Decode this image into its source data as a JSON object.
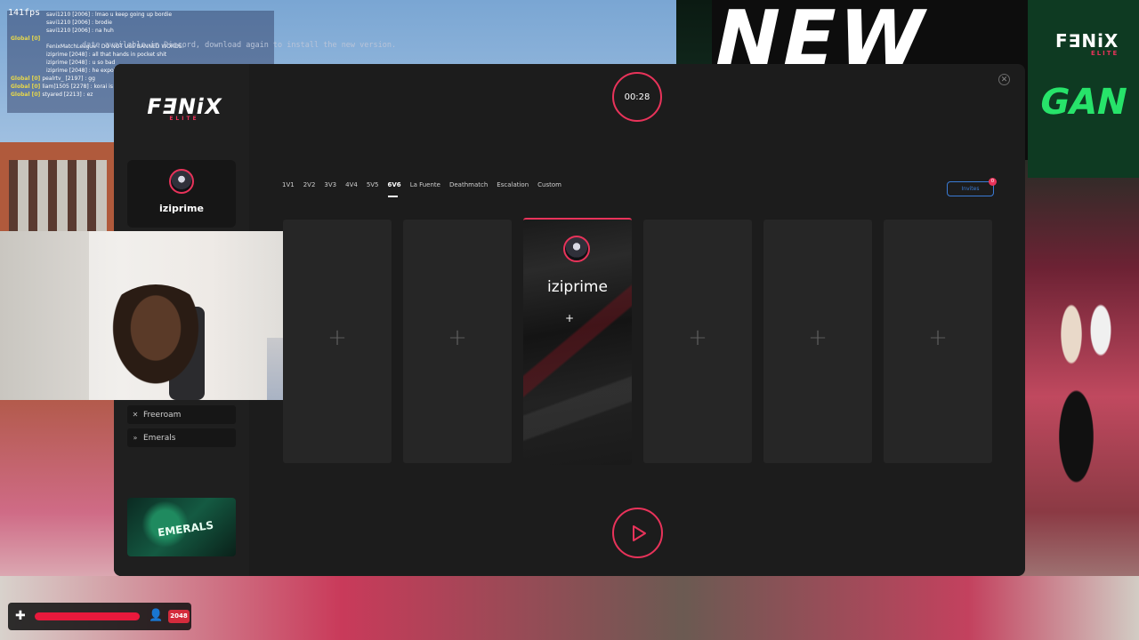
{
  "overlay": {
    "fps": "141fps",
    "update_notice": "date available in Discord, download again to install the new version."
  },
  "chat": {
    "lines": [
      {
        "prefix": "",
        "name": "savi1210 [2006] : ",
        "text": "lmao u keep going up bordie"
      },
      {
        "prefix": "",
        "name": "savi1210 [2006] : ",
        "text": "brodie"
      },
      {
        "prefix": "",
        "name": "savi1210 [2006] : ",
        "text": "na huh"
      },
      {
        "prefix": "Global [0] ",
        "name": "",
        "text": ""
      },
      {
        "prefix": "",
        "name": "FenixMatchLeague : ",
        "text": "DO NOT USE BANNED WORDS!"
      },
      {
        "prefix": "",
        "name": "iziprime [2048] : ",
        "text": "all that hands in pocket shit"
      },
      {
        "prefix": "",
        "name": "iziprime [2048] : ",
        "text": "u so bad"
      },
      {
        "prefix": "",
        "name": "iziprime [2048] : ",
        "text": "he expoiting"
      },
      {
        "prefix": "Global [0] ",
        "name": "pealrtv_ [2197] : ",
        "text": "gg"
      },
      {
        "prefix": "Global [0] ",
        "name": "liam]1505 [2278] : ",
        "text": "korai is cheat"
      },
      {
        "prefix": "Global [0] ",
        "name": "styared [2213] : ",
        "text": "ez"
      }
    ]
  },
  "brand": {
    "name": "F∃NiX",
    "sub": "ELITE",
    "corner_name": "F∃NiX",
    "corner_sub": "ELITE"
  },
  "background": {
    "sign_text": "NEW",
    "sign_text2": "GAN"
  },
  "sidebar": {
    "profile_name": "iziprime",
    "items": [
      {
        "label": "Freeroam",
        "icon": "x-icon"
      },
      {
        "label": "Emerals",
        "icon": "chevrons-icon"
      }
    ],
    "promo_text": "EMERALS"
  },
  "lobby": {
    "timer": "00:28",
    "tabs": [
      {
        "label": "1V1",
        "active": false
      },
      {
        "label": "2V2",
        "active": false
      },
      {
        "label": "3V3",
        "active": false
      },
      {
        "label": "4V4",
        "active": false
      },
      {
        "label": "5V5",
        "active": false
      },
      {
        "label": "6V6",
        "active": true
      },
      {
        "label": "La Fuente",
        "active": false
      },
      {
        "label": "Deathmatch",
        "active": false
      },
      {
        "label": "Escalation",
        "active": false
      },
      {
        "label": "Custom",
        "active": false
      }
    ],
    "invites_label": "Invites",
    "invites_count": "0",
    "slots": [
      {
        "filled": false,
        "plus": "+"
      },
      {
        "filled": false,
        "plus": "+"
      },
      {
        "filled": true,
        "name": "iziprime",
        "add": "+"
      },
      {
        "filled": false,
        "plus": "+"
      },
      {
        "filled": false,
        "plus": "+"
      },
      {
        "filled": false,
        "plus": "+"
      }
    ]
  },
  "hud": {
    "health_fraction": 1.0,
    "player_id": "2048"
  },
  "colors": {
    "accent": "#e8335a",
    "invite_blue": "#3a7bd5",
    "panel_bg": "#1c1c1c"
  }
}
